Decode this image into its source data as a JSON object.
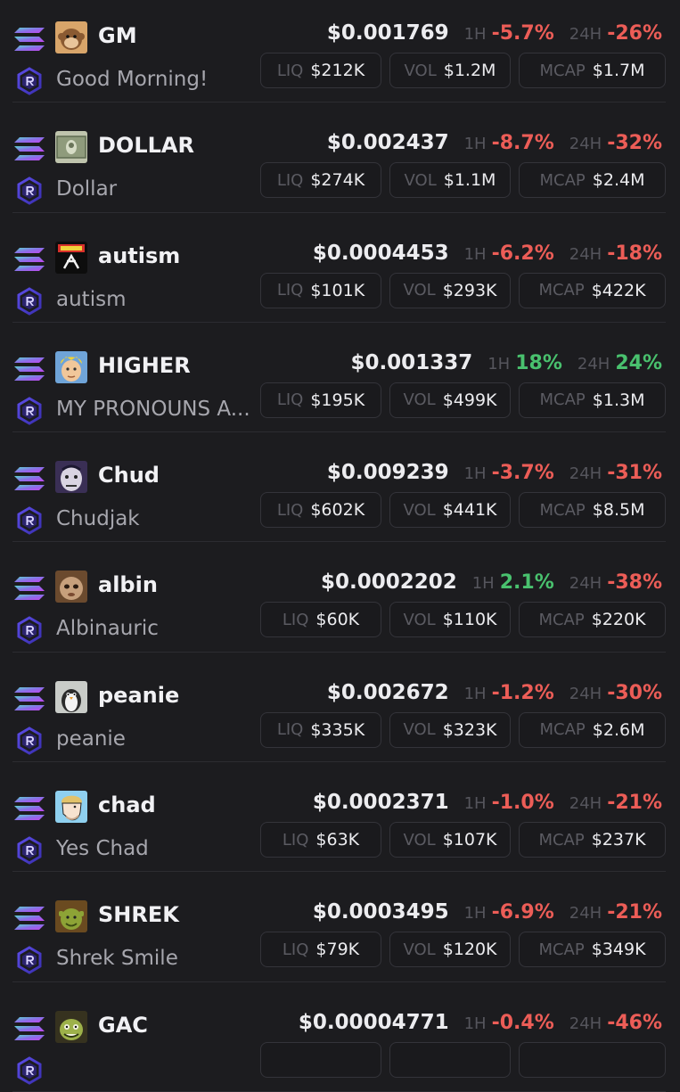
{
  "colors": {
    "positive": "#49c16e",
    "negative": "#ec5d57",
    "background": "#1c1c1f"
  },
  "chain_icon": "solana-icon",
  "dex_icon": "raydium-icon",
  "tokens": [
    {
      "ticker": "GM",
      "name": "Good Morning!",
      "avatar": "monkey-icon",
      "price": "$0.001769",
      "h1_label": "1H",
      "h1": "-5.7%",
      "h1_dir": "down",
      "h24_label": "24H",
      "h24": "-26%",
      "h24_dir": "down",
      "liq_label": "LIQ",
      "liq": "$212K",
      "vol_label": "VOL",
      "vol": "$1.2M",
      "mcap_label": "MCAP",
      "mcap": "$1.7M"
    },
    {
      "ticker": "DOLLAR",
      "name": "Dollar",
      "avatar": "dollar-bill-icon",
      "price": "$0.002437",
      "h1_label": "1H",
      "h1": "-8.7%",
      "h1_dir": "down",
      "h24_label": "24H",
      "h24": "-32%",
      "h24_dir": "down",
      "liq_label": "LIQ",
      "liq": "$274K",
      "vol_label": "VOL",
      "vol": "$1.1M",
      "mcap_label": "MCAP",
      "mcap": "$2.4M"
    },
    {
      "ticker": "autism",
      "name": "autism",
      "avatar": "autism-logo-icon",
      "price": "$0.0004453",
      "h1_label": "1H",
      "h1": "-6.2%",
      "h1_dir": "down",
      "h24_label": "24H",
      "h24": "-18%",
      "h24_dir": "down",
      "liq_label": "LIQ",
      "liq": "$101K",
      "vol_label": "VOL",
      "vol": "$293K",
      "mcap_label": "MCAP",
      "mcap": "$422K"
    },
    {
      "ticker": "HIGHER",
      "name": "MY PRONOUNS A...",
      "avatar": "hero-face-icon",
      "price": "$0.001337",
      "h1_label": "1H",
      "h1": "18%",
      "h1_dir": "up",
      "h24_label": "24H",
      "h24": "24%",
      "h24_dir": "up",
      "liq_label": "LIQ",
      "liq": "$195K",
      "vol_label": "VOL",
      "vol": "$499K",
      "mcap_label": "MCAP",
      "mcap": "$1.3M"
    },
    {
      "ticker": "Chud",
      "name": "Chudjak",
      "avatar": "chudjak-face-icon",
      "price": "$0.009239",
      "h1_label": "1H",
      "h1": "-3.7%",
      "h1_dir": "down",
      "h24_label": "24H",
      "h24": "-31%",
      "h24_dir": "down",
      "liq_label": "LIQ",
      "liq": "$602K",
      "vol_label": "VOL",
      "vol": "$441K",
      "mcap_label": "MCAP",
      "mcap": "$8.5M"
    },
    {
      "ticker": "albin",
      "name": "Albinauric",
      "avatar": "albinauric-face-icon",
      "price": "$0.0002202",
      "h1_label": "1H",
      "h1": "2.1%",
      "h1_dir": "up",
      "h24_label": "24H",
      "h24": "-38%",
      "h24_dir": "down",
      "liq_label": "LIQ",
      "liq": "$60K",
      "vol_label": "VOL",
      "vol": "$110K",
      "mcap_label": "MCAP",
      "mcap": "$220K"
    },
    {
      "ticker": "peanie",
      "name": "peanie",
      "avatar": "penguin-icon",
      "price": "$0.002672",
      "h1_label": "1H",
      "h1": "-1.2%",
      "h1_dir": "down",
      "h24_label": "24H",
      "h24": "-30%",
      "h24_dir": "down",
      "liq_label": "LIQ",
      "liq": "$335K",
      "vol_label": "VOL",
      "vol": "$323K",
      "mcap_label": "MCAP",
      "mcap": "$2.6M"
    },
    {
      "ticker": "chad",
      "name": "Yes Chad",
      "avatar": "chad-face-icon",
      "price": "$0.0002371",
      "h1_label": "1H",
      "h1": "-1.0%",
      "h1_dir": "down",
      "h24_label": "24H",
      "h24": "-21%",
      "h24_dir": "down",
      "liq_label": "LIQ",
      "liq": "$63K",
      "vol_label": "VOL",
      "vol": "$107K",
      "mcap_label": "MCAP",
      "mcap": "$237K"
    },
    {
      "ticker": "SHREK",
      "name": "Shrek Smile",
      "avatar": "shrek-face-icon",
      "price": "$0.0003495",
      "h1_label": "1H",
      "h1": "-6.9%",
      "h1_dir": "down",
      "h24_label": "24H",
      "h24": "-21%",
      "h24_dir": "down",
      "liq_label": "LIQ",
      "liq": "$79K",
      "vol_label": "VOL",
      "vol": "$120K",
      "mcap_label": "MCAP",
      "mcap": "$349K"
    },
    {
      "ticker": "GAC",
      "name": "",
      "avatar": "goblin-face-icon",
      "price": "$0.00004771",
      "h1_label": "1H",
      "h1": "-0.4%",
      "h1_dir": "down",
      "h24_label": "24H",
      "h24": "-46%",
      "h24_dir": "down",
      "liq_label": "",
      "liq": "",
      "vol_label": "",
      "vol": "",
      "mcap_label": "",
      "mcap": ""
    }
  ]
}
